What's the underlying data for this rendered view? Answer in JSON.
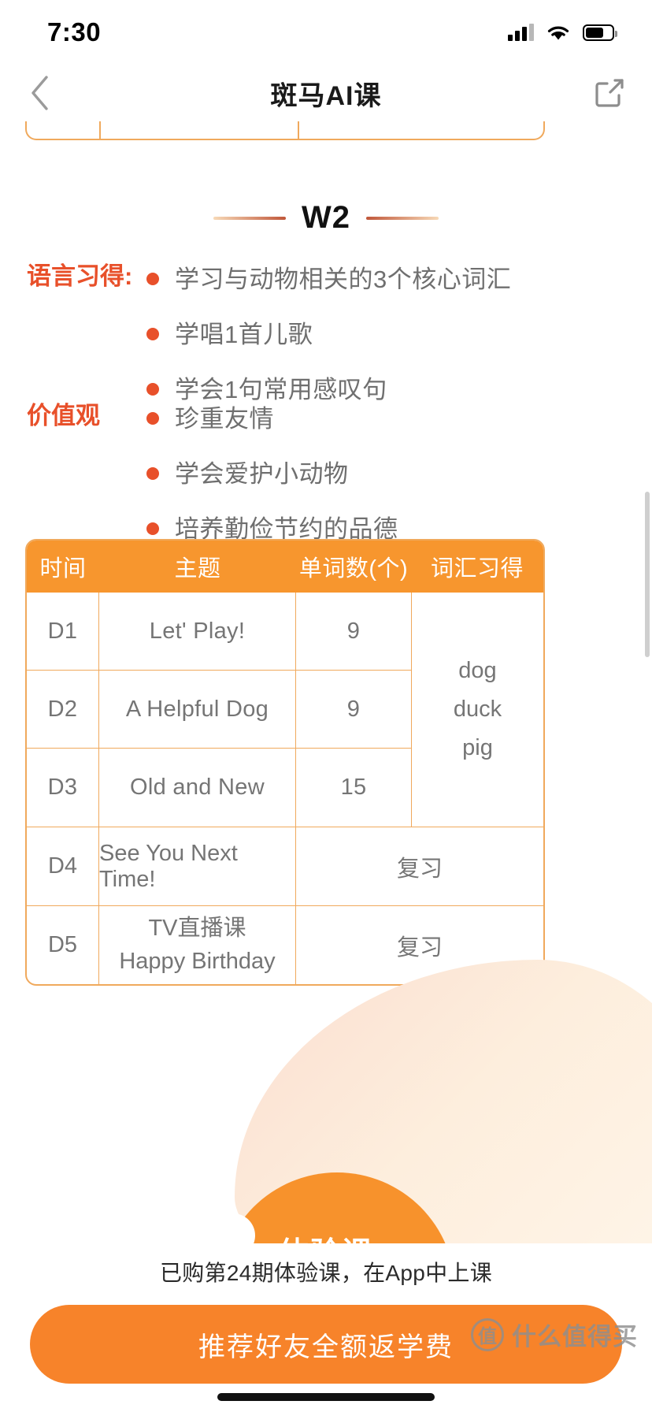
{
  "status_bar": {
    "time": "7:30",
    "signal_icon": "cellular-bars-icon",
    "wifi_icon": "wifi-icon",
    "battery_icon": "battery-icon"
  },
  "nav": {
    "title": "斑马AI课",
    "back_icon": "chevron-left-icon",
    "share_icon": "share-external-icon"
  },
  "week": {
    "label": "W2"
  },
  "sections": [
    {
      "head": "语言习得:",
      "bullets": [
        "学习与动物相关的3个核心词汇",
        "学唱1首儿歌",
        "学会1句常用感叹句"
      ]
    },
    {
      "head": "价值观",
      "bullets": [
        "珍重友情",
        "学会爱护小动物",
        "培养勤俭节约的品德"
      ]
    }
  ],
  "table": {
    "headers": [
      "时间",
      "主题",
      "单词数(个)",
      "词汇习得"
    ],
    "rows": [
      {
        "day": "D1",
        "topic": "Let' Play!",
        "words": "9"
      },
      {
        "day": "D2",
        "topic": "A Helpful Dog",
        "words": "9"
      },
      {
        "day": "D3",
        "topic": "Old and New",
        "words": "15"
      }
    ],
    "vocab": [
      "dog",
      "duck",
      "pig"
    ],
    "review_rows": [
      {
        "day": "D4",
        "topic": "See You Next Time!",
        "note": "复习"
      },
      {
        "day": "D5",
        "topic_line1": "TV直播课",
        "topic_line2": "Happy Birthday",
        "note": "复习"
      }
    ]
  },
  "promo": {
    "blob_text": "体验课"
  },
  "bottom": {
    "note": "已购第24期体验课，在App中上课",
    "cta_label": "推荐好友全额返学费"
  },
  "watermark": {
    "badge": "值",
    "text": "什么值得买"
  },
  "colors": {
    "accent_orange": "#f7922c",
    "header_orange": "#f7962e",
    "cta_orange": "#f7832a",
    "section_red": "#e8502a",
    "border_orange": "#f0a95c",
    "body_gray": "#757575"
  }
}
